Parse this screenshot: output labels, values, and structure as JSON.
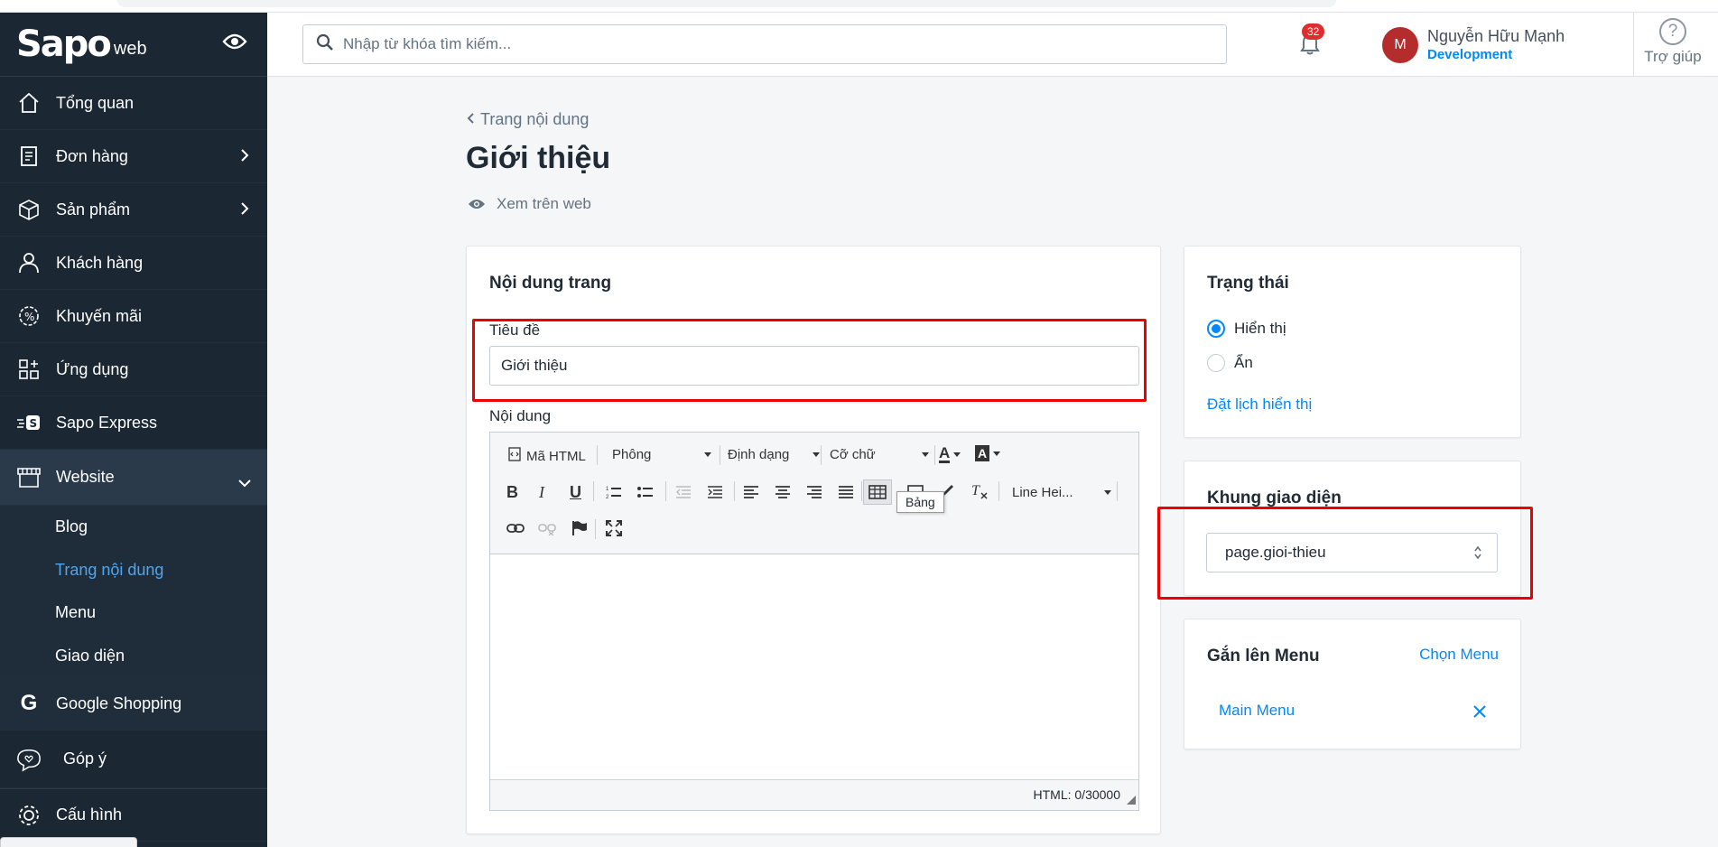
{
  "app": {
    "logo": "Sapo",
    "logo_suffix": "web"
  },
  "sidebar": {
    "items": [
      {
        "label": "Tổng quan",
        "icon": "home-icon"
      },
      {
        "label": "Đơn hàng",
        "icon": "orders-icon"
      },
      {
        "label": "Sản phẩm",
        "icon": "box-icon"
      },
      {
        "label": "Khách hàng",
        "icon": "user-icon"
      },
      {
        "label": "Khuyến mãi",
        "icon": "discount-icon"
      },
      {
        "label": "Ứng dụng",
        "icon": "apps-icon"
      },
      {
        "label": "Sapo Express",
        "icon": "express-icon"
      },
      {
        "label": "Website",
        "icon": "store-icon"
      }
    ],
    "website_sub": [
      {
        "label": "Blog"
      },
      {
        "label": "Trang nội dung"
      },
      {
        "label": "Menu"
      },
      {
        "label": "Giao diện"
      }
    ],
    "google": "Google Shopping",
    "feedback": "Góp ý",
    "config": "Cấu hình"
  },
  "topbar": {
    "search_placeholder": "Nhập từ khóa tìm kiếm...",
    "notification_count": "32",
    "avatar_initial": "M",
    "user_name": "Nguyễn Hữu Mạnh",
    "user_role": "Development",
    "help": "Trợ giúp",
    "help_symbol": "?"
  },
  "page": {
    "breadcrumb": "Trang nội dung",
    "title": "Giới thiệu",
    "view_web": "Xem trên web"
  },
  "content_card": {
    "heading": "Nội dung trang",
    "title_label": "Tiêu đề",
    "title_value": "Giới thiệu",
    "content_label": "Nội dung",
    "toolbar": {
      "html": "Mã HTML",
      "font": "Phông",
      "format": "Định dạng",
      "size": "Cỡ chữ",
      "line_height": "Line Hei...",
      "font_color_glyph": "A",
      "bg_color_glyph": "A"
    },
    "tooltip": "Bảng",
    "status": "HTML: 0/30000"
  },
  "status_card": {
    "heading": "Trạng thái",
    "options": [
      {
        "label": "Hiển thị",
        "checked": true
      },
      {
        "label": "Ẩn",
        "checked": false
      }
    ],
    "schedule_link": "Đặt lịch hiển thị"
  },
  "template_card": {
    "heading": "Khung giao diện",
    "selected": "page.gioi-thieu"
  },
  "menu_card": {
    "heading": "Gắn lên Menu",
    "choose": "Chọn Menu",
    "menu_item": "Main Menu"
  },
  "colors": {
    "sidebar": "#1b2733",
    "accent": "#0088ff",
    "highlight": "#e00000",
    "background": "#f4f6f8"
  }
}
